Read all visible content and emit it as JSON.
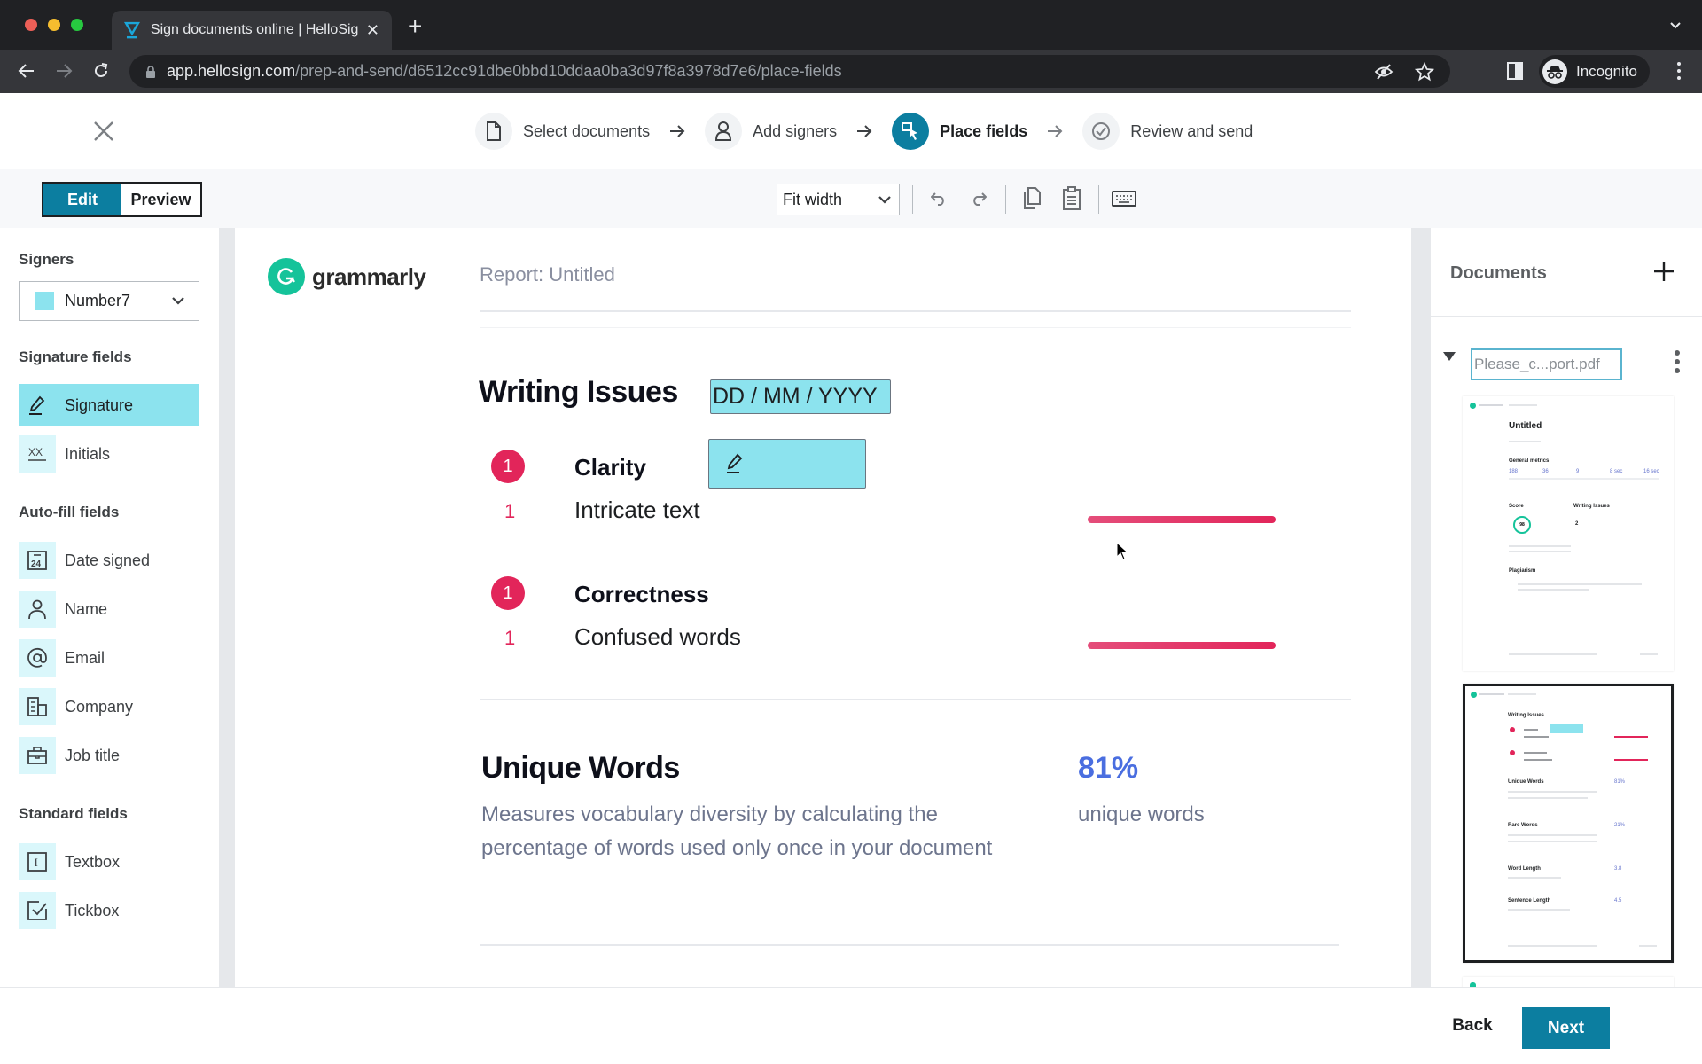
{
  "browser": {
    "tab_title": "Sign documents online | HelloSign",
    "url_host": "app.hellosign.com",
    "url_path": "/prep-and-send/d6512cc91dbe0bbd10ddaa0ba3d97f8a3978d7e6/place-fields",
    "profile_label": "Incognito"
  },
  "stepper": {
    "steps": [
      {
        "label": "Select documents",
        "icon": "document-icon",
        "state": "done"
      },
      {
        "label": "Add signers",
        "icon": "person-icon",
        "state": "done"
      },
      {
        "label": "Place fields",
        "icon": "cursor-field-icon",
        "state": "active"
      },
      {
        "label": "Review and send",
        "icon": "check-circle-icon",
        "state": "upcoming"
      }
    ]
  },
  "toolbar": {
    "edit_label": "Edit",
    "preview_label": "Preview",
    "active_mode": "Edit",
    "zoom_value": "Fit width"
  },
  "sidebar": {
    "signers_heading": "Signers",
    "selected_signer": "Number7",
    "signer_color": "#8ce3ee",
    "signature_heading": "Signature fields",
    "signature_fields": [
      {
        "label": "Signature",
        "icon": "pen-icon",
        "selected": true
      },
      {
        "label": "Initials",
        "icon": "initials-icon",
        "selected": false
      }
    ],
    "autofill_heading": "Auto-fill fields",
    "autofill_fields": [
      {
        "label": "Date signed",
        "icon": "calendar-icon",
        "calendar_day": "24"
      },
      {
        "label": "Name",
        "icon": "person-icon"
      },
      {
        "label": "Email",
        "icon": "at-icon"
      },
      {
        "label": "Company",
        "icon": "building-icon"
      },
      {
        "label": "Job title",
        "icon": "briefcase-icon"
      }
    ],
    "standard_heading": "Standard fields",
    "standard_fields": [
      {
        "label": "Textbox",
        "icon": "textbox-icon",
        "glyph": "I"
      },
      {
        "label": "Tickbox",
        "icon": "checkbox-icon"
      }
    ]
  },
  "document": {
    "logo_text": "grammarly",
    "report_title": "Report: Untitled",
    "writing_issues_heading": "Writing Issues",
    "placed_date_field": "DD / MM / YYYY",
    "categories": [
      {
        "count": "1",
        "title": "Clarity",
        "item_count": "1",
        "item": "Intricate text"
      },
      {
        "count": "1",
        "title": "Correctness",
        "item_count": "1",
        "item": "Confused words"
      }
    ],
    "unique_words": {
      "heading": "Unique Words",
      "description": "Measures vocabulary diversity by calculating the percentage of words used only once in your document",
      "value": "81%",
      "unit": "unique words"
    }
  },
  "documents_panel": {
    "title": "Documents",
    "filename": "Please_c...port.pdf",
    "thumbnails": [
      {
        "page": 1,
        "selected": false,
        "title": "Untitled",
        "sections": [
          "General metrics",
          "Score",
          "Writing Issues",
          "Plagiarism"
        ],
        "metrics": [
          "188",
          "36",
          "9",
          "8 sec",
          "16 sec"
        ],
        "score": "98",
        "issues_left": "2"
      },
      {
        "page": 2,
        "selected": true,
        "sections": [
          "Writing Issues",
          "Unique Words",
          "Rare Words",
          "Word Length",
          "Sentence Length"
        ],
        "values": [
          "81%",
          "21%",
          "3.8",
          "4.5"
        ]
      }
    ]
  },
  "footer": {
    "back_label": "Back",
    "next_label": "Next"
  },
  "colors": {
    "brand": "#0c7ea0",
    "field_fill": "#8ce3ee",
    "issue_red": "#e2255a",
    "metric_blue": "#4a6ee0",
    "grammarly_green": "#15c39a"
  }
}
